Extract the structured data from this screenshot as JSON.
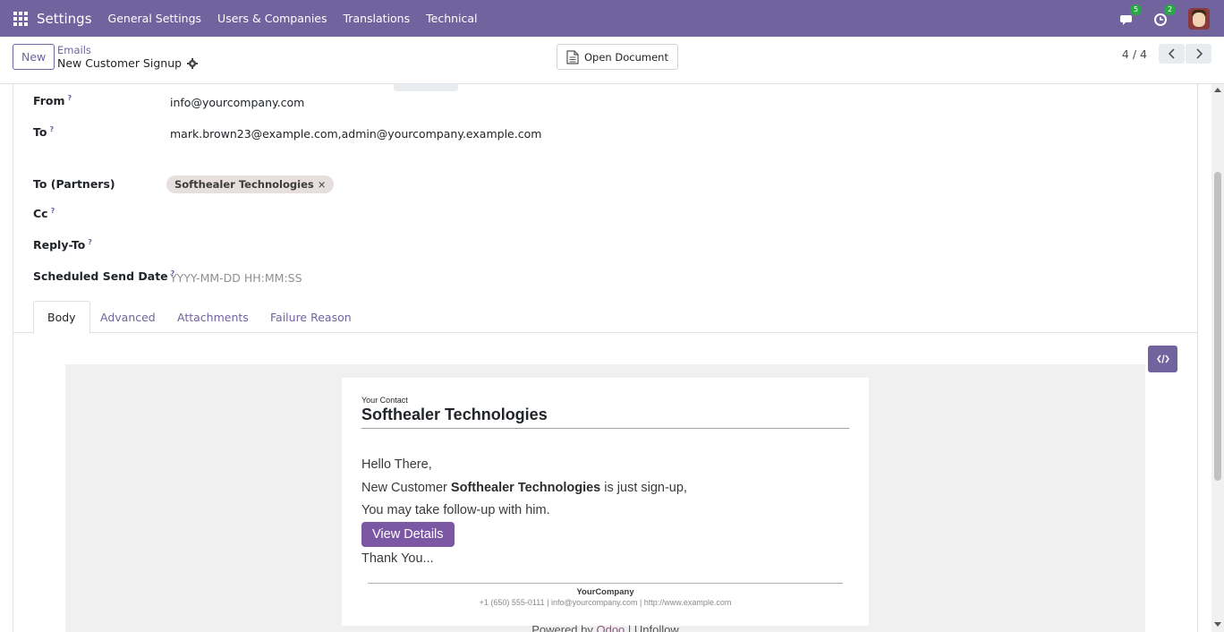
{
  "navbar": {
    "brand": "Settings",
    "items": [
      "General Settings",
      "Users & Companies",
      "Translations",
      "Technical"
    ],
    "messages_badge": "5",
    "activities_badge": "2"
  },
  "control_panel": {
    "new_label": "New",
    "breadcrumb_parent": "Emails",
    "breadcrumb_current": "New Customer Signup",
    "open_document_label": "Open Document",
    "pager": "4 / 4"
  },
  "fields": {
    "from": {
      "label": "From",
      "help": "?",
      "value": "info@yourcompany.com"
    },
    "to": {
      "label": "To",
      "help": "?",
      "value": "mark.brown23@example.com,admin@yourcompany.example.com"
    },
    "to_partners": {
      "label": "To (Partners)",
      "tag": "Softhealer Technologies",
      "remove": "×"
    },
    "cc": {
      "label": "Cc",
      "help": "?"
    },
    "reply_to": {
      "label": "Reply-To",
      "help": "?"
    },
    "scheduled": {
      "label": "Scheduled Send Date",
      "help": "?",
      "placeholder": "YYYY-MM-DD HH:MM:SS"
    }
  },
  "tabs": [
    "Body",
    "Advanced",
    "Attachments",
    "Failure Reason"
  ],
  "mail": {
    "contact_label": "Your Contact",
    "contact_name": "Softhealer Technologies",
    "greeting": "Hello There,",
    "line1_prefix": "New Customer ",
    "line1_bold": "Softhealer Technologies",
    "line1_suffix": " is just sign-up,",
    "line2": "You may take follow-up with him.",
    "button": "View Details",
    "closing": "Thank You...",
    "company": "YourCompany",
    "footer": "+1 (650) 555-0111 | info@yourcompany.com | http://www.example.com",
    "powered_prefix": "Powered by ",
    "powered_brand": "Odoo",
    "powered_suffix": " | Unfollow"
  },
  "colors": {
    "brand": "#71639e",
    "button": "#7c57a4",
    "badge": "#28a745"
  }
}
